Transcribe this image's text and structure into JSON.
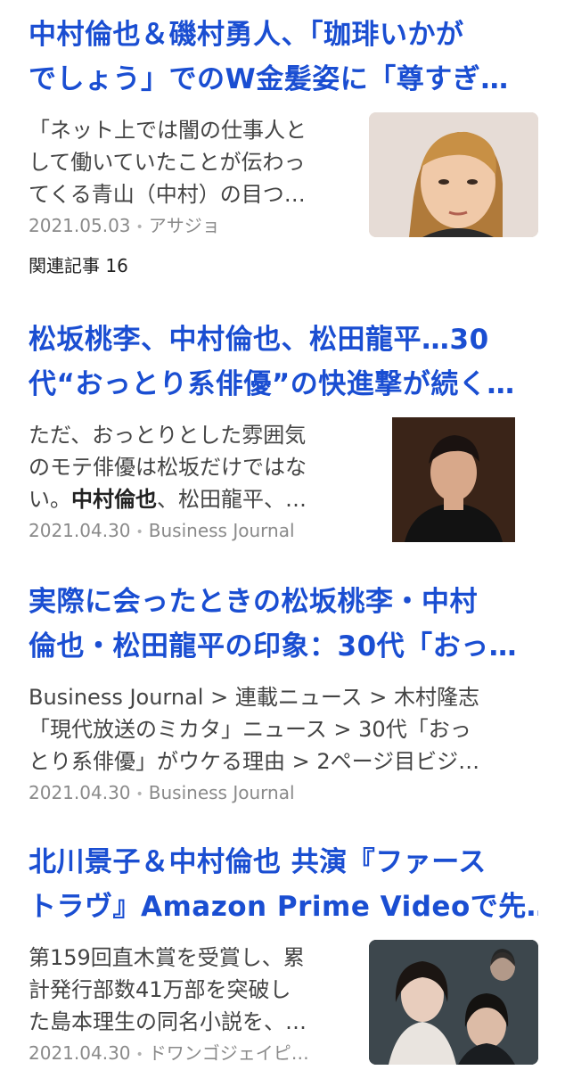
{
  "articles": [
    {
      "title_lines": [
        "中村倫也＆磯村勇人、「珈琲いかが",
        "でしょう」でのW金髪姿に「尊すぎ…"
      ],
      "snippet_lines": [
        "「ネット上では闇の仕事人と",
        "して働いていたことが伝わっ",
        "てくる青山（中村）の目つ…"
      ],
      "date": "2021.05.03",
      "source": "アサジョ",
      "thumb": "photo-man-portrait"
    },
    {
      "title_lines": [
        "松坂桃李、中村倫也、松田龍平…30",
        "代“おっとり系俳優”の快進撃が続く…"
      ],
      "snippet_lines": [
        "ただ、おっとりとした雰囲気",
        "のモテ俳優は松坂だけではな"
      ],
      "snippet_line3_pre": "い。",
      "snippet_line3_bold": "中村倫也",
      "snippet_line3_post": "、松田龍平、…",
      "date": "2021.04.30",
      "source": "Business Journal",
      "thumb": "photo-man-dark-background"
    },
    {
      "title_lines": [
        "実際に会ったときの松坂桃李・中村",
        "倫也・松田龍平の印象：30代「おっ…"
      ],
      "snippet_lines": [
        "Business Journal > 連載ニュース > 木村隆志",
        "「現代放送のミカタ」ニュース > 30代「おっ",
        "とり系俳優」がウケる理由 > 2ページ目ビジ…"
      ],
      "date": "2021.04.30",
      "source": "Business Journal"
    },
    {
      "title_lines": [
        "北川景子＆中村倫也 共演『ファース",
        "トラヴ』Amazon Prime Videoで先…"
      ],
      "snippet_lines": [
        "第159回直木賞を受賞し、累",
        "計発行部数41万部を突破し",
        "た島本理生の同名小説を、…"
      ],
      "date": "2021.04.30",
      "source": "ドワンゴジェイピ…",
      "thumb": "photo-drama-poster"
    }
  ],
  "related": {
    "label": "関連記事 16"
  },
  "meta_separator": "•"
}
